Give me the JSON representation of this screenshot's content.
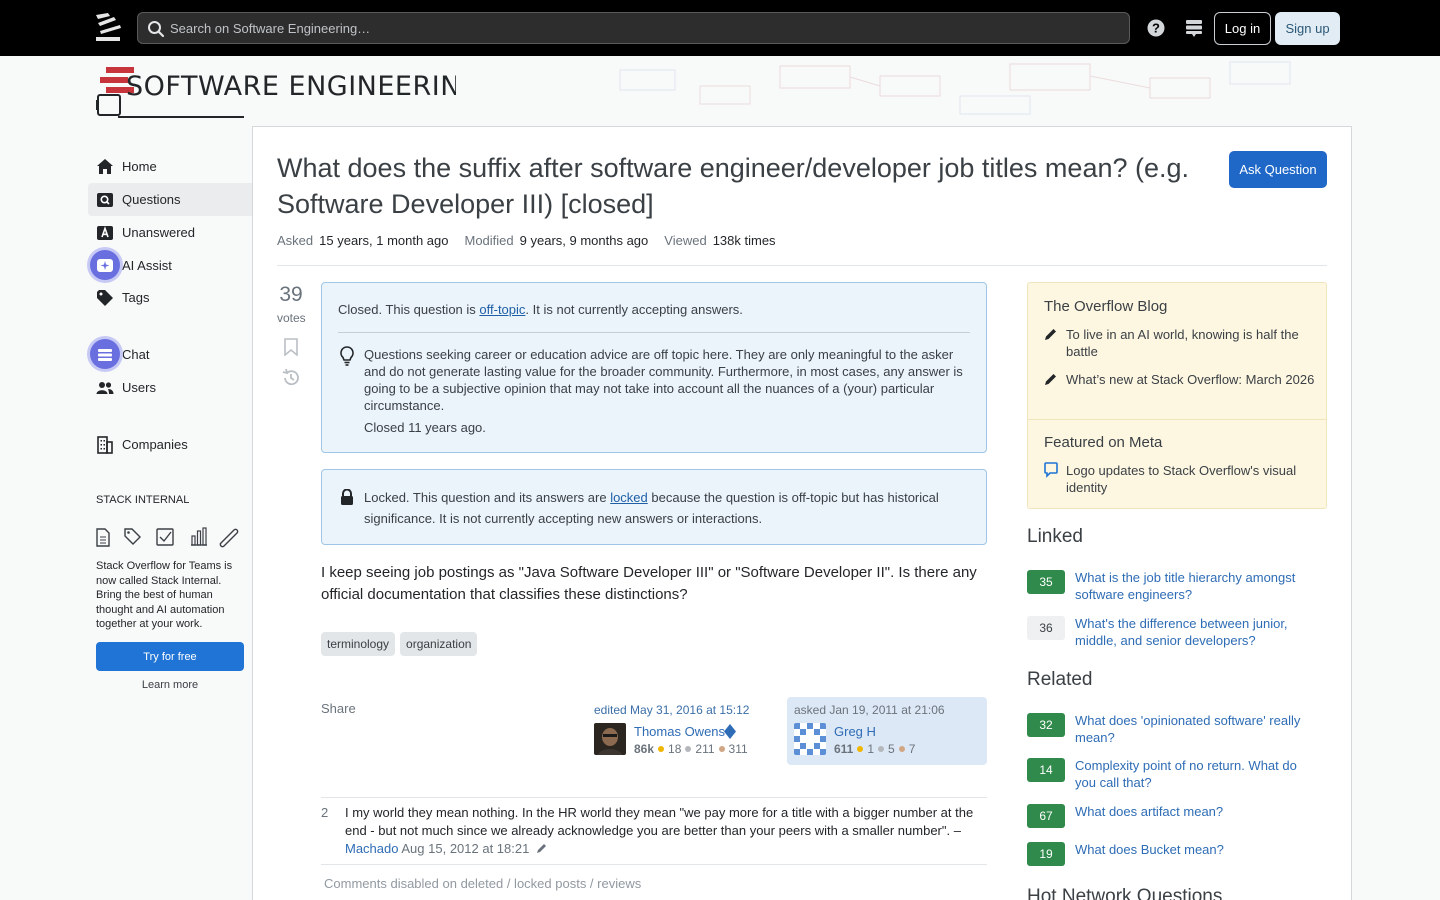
{
  "topbar": {
    "search_placeholder": "Search on Software Engineering…",
    "login_label": "Log in",
    "signup_label": "Sign up"
  },
  "site": {
    "logo_text": "SOFTWARE ENGINEERING"
  },
  "sidebar": {
    "items": [
      {
        "label": "Home",
        "icon": "home-icon"
      },
      {
        "label": "Questions",
        "icon": "questions-icon"
      },
      {
        "label": "Unanswered",
        "icon": "unanswered-icon"
      },
      {
        "label": "AI Assist",
        "icon": "ai-assist-icon"
      },
      {
        "label": "Tags",
        "icon": "tag-icon"
      },
      {
        "label": "Chat",
        "icon": "chat-icon"
      },
      {
        "label": "Users",
        "icon": "users-icon"
      },
      {
        "label": "Companies",
        "icon": "companies-icon"
      }
    ],
    "stack_internal_heading": "STACK INTERNAL",
    "stack_internal_text": "Stack Overflow for Teams is now called Stack Internal. Bring the best of human thought and AI automation together at your work.",
    "try_label": "Try for free",
    "learn_more_label": "Learn more"
  },
  "question": {
    "title": "What does the suffix after software engineer/developer job titles mean? (e.g. Software Developer III) [closed]",
    "ask_button": "Ask Question",
    "asked_label": "Asked",
    "asked_value": "15 years, 1 month ago",
    "modified_label": "Modified",
    "modified_value": "9 years, 9 months ago",
    "viewed_label": "Viewed",
    "viewed_value": "138k times",
    "votes": "39",
    "votes_label": "votes",
    "closed_prefix": "Closed. This question is ",
    "closed_link": "off-topic",
    "closed_suffix": ". It is not currently accepting answers.",
    "closed_reason": "Questions seeking career or education advice are off topic here. They are only meaningful to the asker and do not generate lasting value for the broader community. Furthermore, in most cases, any answer is going to be a subjective opinion that may not take into account all the nuances of a (your) particular circumstance.",
    "closed_when": "Closed 11 years ago.",
    "locked_prefix": "Locked. This question and its answers are ",
    "locked_link": "locked",
    "locked_suffix": " because the question is off-topic but has historical significance. It is not currently accepting new answers or interactions.",
    "body": "I keep seeing job postings as \"Java Software Developer III\" or \"Software Developer II\". Is there any official documentation that classifies these distinctions?",
    "tags": [
      "terminology",
      "organization"
    ],
    "share_label": "Share",
    "editor": {
      "time": "edited May 31, 2016 at 15:12",
      "name": "Thomas Owens",
      "rep": "86k",
      "gold": "18",
      "silver": "211",
      "bronze": "311"
    },
    "asker": {
      "time": "asked Jan 19, 2011 at 21:06",
      "name": "Greg H",
      "rep": "611",
      "gold": "1",
      "silver": "5",
      "bronze": "7"
    }
  },
  "comment": {
    "score": "2",
    "text": "I my world they mean nothing. In the HR world they mean \"we pay more for a title with a bigger number at the end - but not much since we already acknowledge you are better than your peers with a smaller number\".",
    "dash": "–",
    "user": "Machado",
    "time": "Aug 15, 2012 at 18:21",
    "disabled_note": "Comments disabled on deleted / locked posts / reviews"
  },
  "right": {
    "blog_heading": "The Overflow Blog",
    "blog_items": [
      "To live in an AI world, knowing is half the battle",
      "What’s new at Stack Overflow: March 2026"
    ],
    "meta_heading": "Featured on Meta",
    "meta_items": [
      "Logo updates to Stack Overflow's visual identity"
    ],
    "linked_heading": "Linked",
    "linked": [
      {
        "score": "35",
        "title": "What is the job title hierarchy amongst software engineers?",
        "answered": true
      },
      {
        "score": "36",
        "title": "What's the difference between junior, middle, and senior developers?",
        "answered": false
      }
    ],
    "related_heading": "Related",
    "related": [
      {
        "score": "32",
        "title": "What does 'opinionated software' really mean?"
      },
      {
        "score": "14",
        "title": "Complexity point of no return. What do you call that?"
      },
      {
        "score": "67",
        "title": "What does artifact mean?"
      },
      {
        "score": "19",
        "title": "What does Bucket mean?"
      }
    ],
    "hot_heading": "Hot Network Questions"
  },
  "colors": {
    "accent": "#1f68c7",
    "answered_badge": "#2f8a4b",
    "notice_bg": "#ebf4fb",
    "blog_bg": "#fdf7e2"
  }
}
